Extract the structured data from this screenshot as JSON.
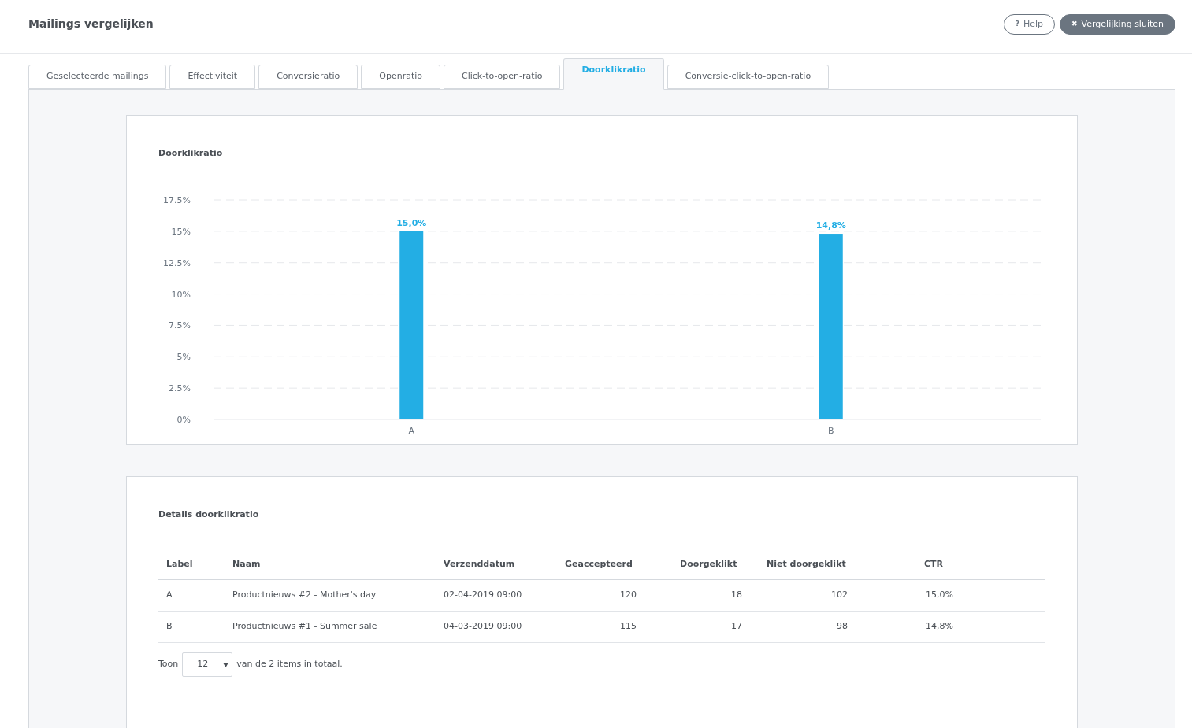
{
  "header": {
    "title": "Mailings vergelijken",
    "buttons": [
      {
        "kind": "help",
        "icon": "?",
        "label": "Help"
      },
      {
        "kind": "close",
        "icon": "✖",
        "label": "Vergelijking sluiten"
      }
    ]
  },
  "tabs": [
    {
      "label": "Geselecteerde mailings",
      "selected": false
    },
    {
      "label": "Effectiviteit",
      "selected": false
    },
    {
      "label": "Conversieratio",
      "selected": false
    },
    {
      "label": "Openratio",
      "selected": false
    },
    {
      "label": "Click-to-open-ratio",
      "selected": false
    },
    {
      "label": "Doorklikratio",
      "selected": true
    },
    {
      "label": "Conversie-click-to-open-ratio",
      "selected": false
    }
  ],
  "chart_card": {
    "title": "Doorklikratio",
    "chart_data": {
      "type": "bar",
      "categories": [
        "A",
        "B"
      ],
      "series": [
        {
          "color": "#23aee4",
          "values": [
            15.0,
            14.8
          ]
        }
      ],
      "ylim": [
        0,
        17.5
      ],
      "grid": true,
      "yticks": [
        {
          "value": 0,
          "label": "0%"
        },
        {
          "value": 2.5,
          "label": "2.5%"
        },
        {
          "value": 5,
          "label": "5%"
        },
        {
          "value": 7.5,
          "label": "7.5%"
        },
        {
          "value": 10,
          "label": "10%"
        },
        {
          "value": 12.5,
          "label": "12.5%"
        },
        {
          "value": 15,
          "label": "15%"
        },
        {
          "value": 17.5,
          "label": "17.5%"
        }
      ],
      "value_labels": [
        "15,0%",
        "14,8%"
      ]
    }
  },
  "details_card": {
    "title": "Details doorklikratio",
    "table": {
      "columns": [
        "Label",
        "Naam",
        "Verzenddatum",
        "Geaccepteerd",
        "Doorgeklikt",
        "Niet doorgeklikt",
        "CTR"
      ],
      "rows": [
        [
          "A",
          "Productnieuws #2 - Mother's day",
          "02-04-2019 09:00",
          "120",
          "18",
          "102",
          "15,0%"
        ],
        [
          "B",
          "Productnieuws #1 - Summer sale",
          "04-03-2019 09:00",
          "115",
          "17",
          "98",
          "14,8%"
        ]
      ]
    },
    "pager": {
      "prefix": "Toon",
      "page_size": "12",
      "suffix": "van de 2 items in totaal."
    }
  }
}
